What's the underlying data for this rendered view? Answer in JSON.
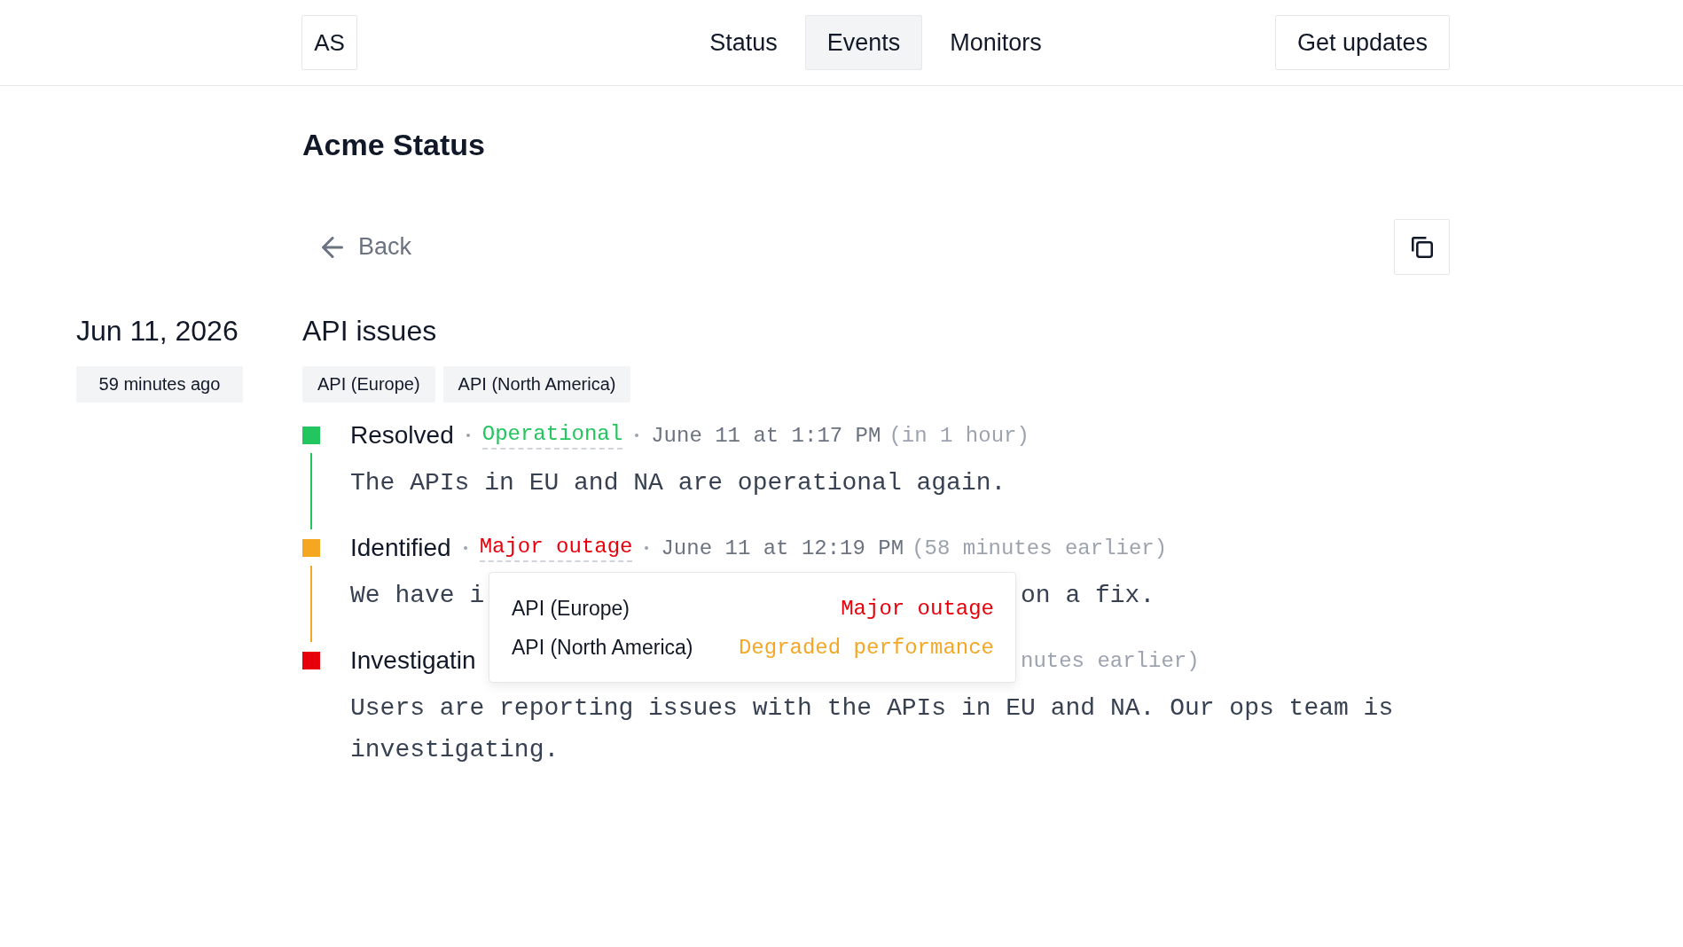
{
  "header": {
    "logo": "AS",
    "nav": [
      {
        "label": "Status",
        "selected": false
      },
      {
        "label": "Events",
        "selected": true
      },
      {
        "label": "Monitors",
        "selected": false
      }
    ],
    "cta": "Get updates"
  },
  "page_title": "Acme Status",
  "back_link": "Back",
  "event": {
    "date": "Jun 11, 2026",
    "age": "59 minutes ago",
    "title": "API issues",
    "tags": [
      "API (Europe)",
      "API (North America)"
    ],
    "updates": [
      {
        "status": "Resolved",
        "color": "#22c55e",
        "impact": {
          "label": "Operational",
          "color": "#22c55e"
        },
        "time": "June 11 at 1:17 PM",
        "relative": "(in 1 hour)",
        "message": [
          "The APIs in EU and NA are operational again."
        ]
      },
      {
        "status": "Identified",
        "color": "#f5a623",
        "impact": {
          "label": "Major outage",
          "color": "#e7000b"
        },
        "time": "June 11 at 12:19 PM",
        "relative": "(58 minutes earlier)",
        "message": [
          "We have i",
          "on a fix."
        ],
        "tooltip": {
          "rows": [
            {
              "component": "API (Europe)",
              "status": "Major outage",
              "color": "#e7000b"
            },
            {
              "component": "API (North America)",
              "status": "Degraded performance",
              "color": "#f5a623"
            }
          ]
        }
      },
      {
        "status": "Investigatin",
        "color": "#e7000b",
        "relative": "nutes earlier)",
        "message": [
          "Users are reporting issues with the APIs in EU and NA. Our ops team is investigating."
        ]
      }
    ]
  }
}
